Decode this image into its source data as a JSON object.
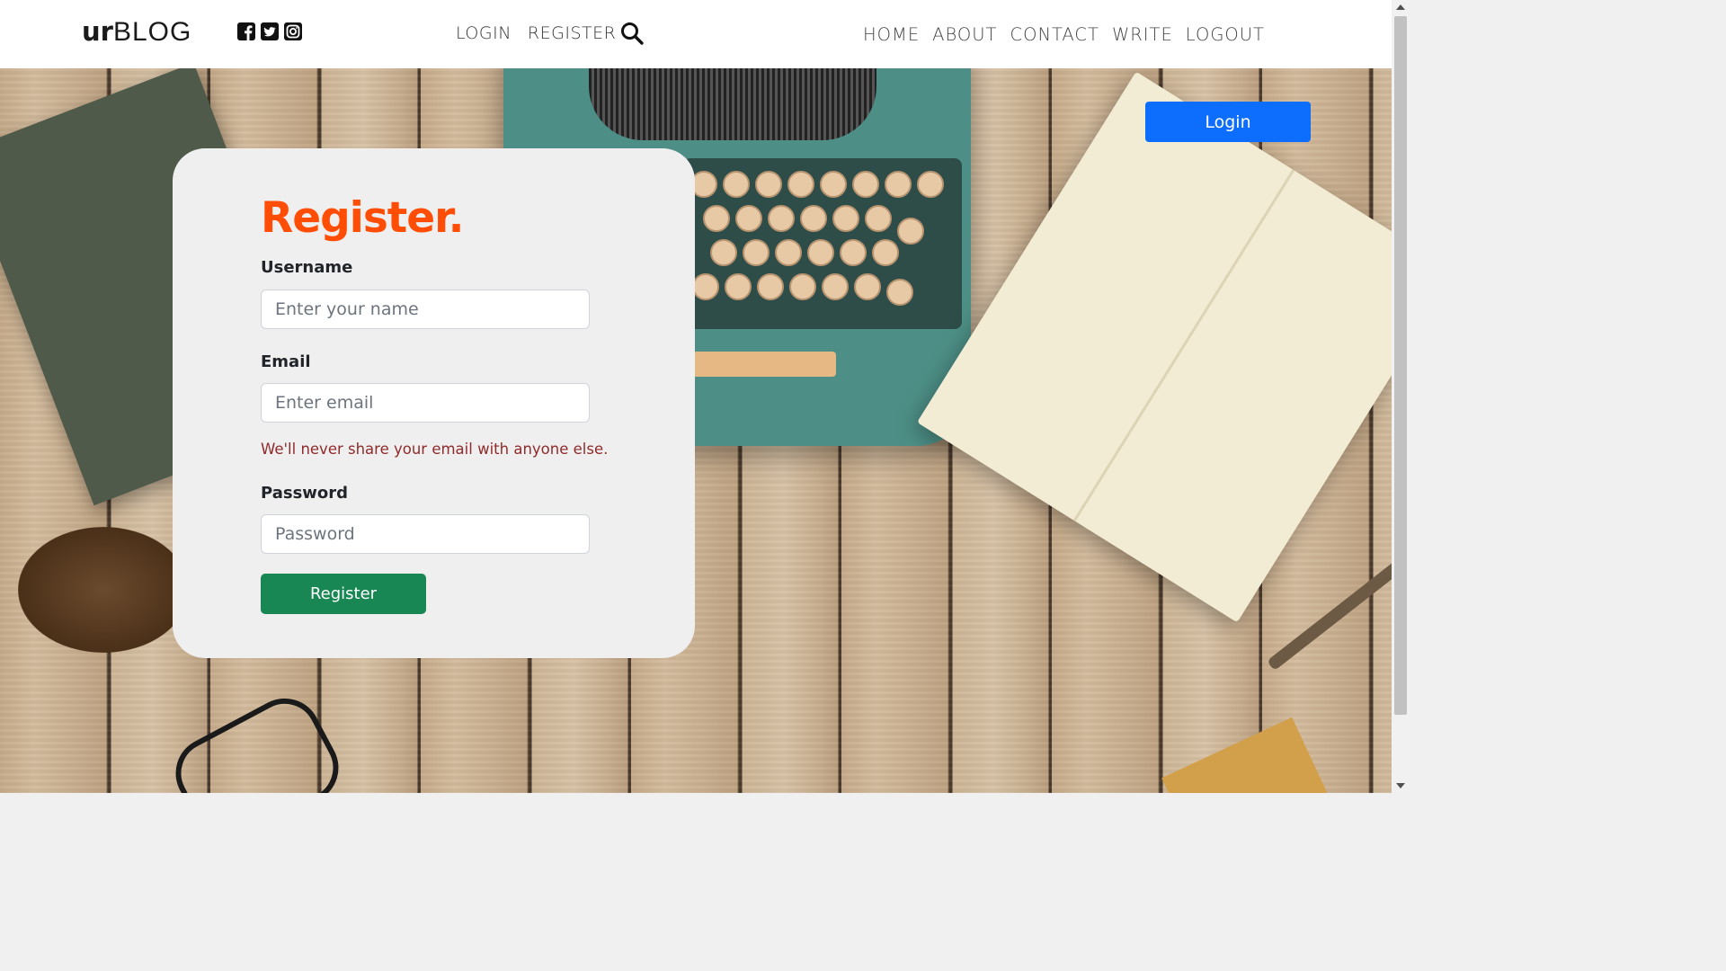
{
  "brand": {
    "bold": "ur",
    "light": "BLOG"
  },
  "social": [
    {
      "icon": "facebook-square-icon"
    },
    {
      "icon": "twitter-square-icon"
    },
    {
      "icon": "instagram-icon"
    }
  ],
  "center_nav": {
    "login": "LOGIN",
    "register": "REGISTER",
    "search_icon": "search-icon"
  },
  "right_nav": {
    "home": "HOME",
    "about": "ABOUT",
    "contact": "CONTACT",
    "write": "WRITE",
    "logout": "LOGOUT"
  },
  "hero": {
    "login_button": "Login"
  },
  "form": {
    "title": "Register.",
    "username_label": "Username",
    "username_placeholder": "Enter your name",
    "email_label": "Email",
    "email_placeholder": "Enter email",
    "email_help": "We'll never share your email with anyone else.",
    "password_label": "Password",
    "password_placeholder": "Password",
    "submit_label": "Register"
  },
  "colors": {
    "accent_title": "#ff4d06",
    "primary_button": "#0d6efd",
    "success_button": "#198754",
    "help_text": "#8f2b2b"
  }
}
